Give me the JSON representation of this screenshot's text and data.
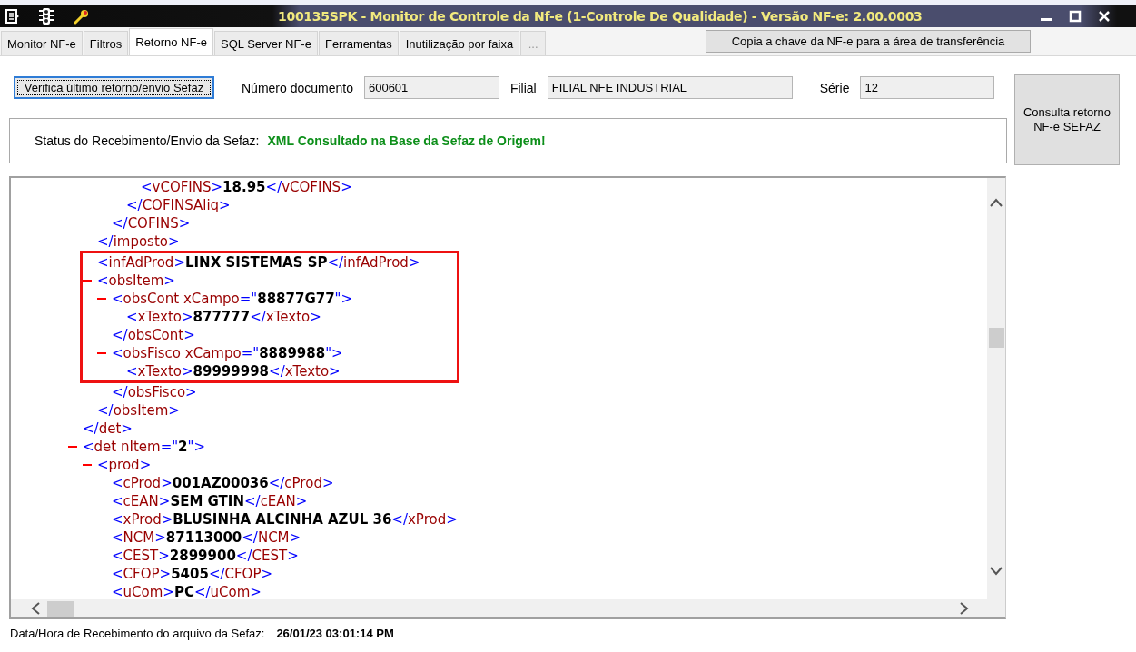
{
  "window": {
    "title": "100135SPK - Monitor de Controle da Nf-e (1-Controle De Qualidade) - Versão NF-e: 2.00.0003"
  },
  "tabs": [
    {
      "label": "Monitor NF-e",
      "selected": false
    },
    {
      "label": "Filtros",
      "selected": false
    },
    {
      "label": "Retorno NF-e",
      "selected": true
    },
    {
      "label": "SQL Server NF-e",
      "selected": false
    },
    {
      "label": "Ferramentas",
      "selected": false
    },
    {
      "label": "Inutilização por faixa",
      "selected": false
    },
    {
      "label": "...",
      "selected": false
    }
  ],
  "copy_key_button": "Copia a chave da NF-e para a área de transferência",
  "verify_button": "Verifica último retorno/envio Sefaz",
  "fields": [
    {
      "label": "Número documento",
      "value": "600601"
    },
    {
      "label": "Filial",
      "value": "FILIAL NFE INDUSTRIAL"
    },
    {
      "label": "Série",
      "value": "12"
    }
  ],
  "query_button": "Consulta retorno NF-e SEFAZ",
  "status": {
    "label": "Status do Recebimento/Envio da Sefaz:",
    "value": "XML Consultado na Base da Sefaz de Origem!"
  },
  "xml_view": {
    "nodes": [
      {
        "children": [
          {
            "children": [
              {
                "children": [
                  {
                    "children": [
                      {
                        "open": {
                          "highlighted": false,
                          "parts": [
                            {
                              "kind": "punct",
                              "text": "<"
                            },
                            {
                              "kind": "name",
                              "text": "vCOFINS"
                            },
                            {
                              "kind": "punct",
                              "text": ">"
                            },
                            {
                              "kind": "value",
                              "text": "18.95"
                            },
                            {
                              "kind": "punct",
                              "text": "</"
                            },
                            {
                              "kind": "name",
                              "text": "vCOFINS"
                            },
                            {
                              "kind": "punct",
                              "text": ">"
                            }
                          ]
                        }
                      }
                    ],
                    "close": {
                      "highlighted": false,
                      "parts": [
                        {
                          "kind": "punct",
                          "text": "</"
                        },
                        {
                          "kind": "name",
                          "text": "COFINSAliq"
                        },
                        {
                          "kind": "punct",
                          "text": ">"
                        }
                      ]
                    }
                  }
                ],
                "close": {
                  "highlighted": false,
                  "parts": [
                    {
                      "kind": "punct",
                      "text": "</"
                    },
                    {
                      "kind": "name",
                      "text": "COFINS"
                    },
                    {
                      "kind": "punct",
                      "text": ">"
                    }
                  ]
                }
              }
            ],
            "close": {
              "highlighted": false,
              "parts": [
                {
                  "kind": "punct",
                  "text": "</"
                },
                {
                  "kind": "name",
                  "text": "imposto"
                },
                {
                  "kind": "punct",
                  "text": ">"
                }
              ]
            }
          },
          {
            "open": {
              "highlighted": true,
              "parts": [
                {
                  "kind": "punct",
                  "text": "<"
                },
                {
                  "kind": "name",
                  "text": "infAdProd"
                },
                {
                  "kind": "punct",
                  "text": ">"
                },
                {
                  "kind": "value",
                  "text": "LINX SISTEMAS SP"
                },
                {
                  "kind": "punct",
                  "text": "</"
                },
                {
                  "kind": "name",
                  "text": "infAdProd"
                },
                {
                  "kind": "punct",
                  "text": ">"
                }
              ]
            }
          },
          {
            "expanded": true,
            "open": {
              "highlighted": true,
              "parts": [
                {
                  "kind": "punct",
                  "text": "<"
                },
                {
                  "kind": "name",
                  "text": "obsItem"
                },
                {
                  "kind": "punct",
                  "text": ">"
                }
              ]
            },
            "children": [
              {
                "expanded": true,
                "open": {
                  "highlighted": true,
                  "parts": [
                    {
                      "kind": "punct",
                      "text": "<"
                    },
                    {
                      "kind": "name",
                      "text": "obsCont xCampo"
                    },
                    {
                      "kind": "punct",
                      "text": "=\""
                    },
                    {
                      "kind": "value",
                      "text": "88877G77"
                    },
                    {
                      "kind": "punct",
                      "text": "\">"
                    }
                  ]
                },
                "children": [
                  {
                    "open": {
                      "highlighted": true,
                      "parts": [
                        {
                          "kind": "punct",
                          "text": "<"
                        },
                        {
                          "kind": "name",
                          "text": "xTexto"
                        },
                        {
                          "kind": "punct",
                          "text": ">"
                        },
                        {
                          "kind": "value",
                          "text": "877777"
                        },
                        {
                          "kind": "punct",
                          "text": "</"
                        },
                        {
                          "kind": "name",
                          "text": "xTexto"
                        },
                        {
                          "kind": "punct",
                          "text": ">"
                        }
                      ]
                    }
                  }
                ],
                "close": {
                  "highlighted": true,
                  "parts": [
                    {
                      "kind": "punct",
                      "text": "</"
                    },
                    {
                      "kind": "name",
                      "text": "obsCont"
                    },
                    {
                      "kind": "punct",
                      "text": ">"
                    }
                  ]
                }
              },
              {
                "expanded": true,
                "open": {
                  "highlighted": true,
                  "parts": [
                    {
                      "kind": "punct",
                      "text": "<"
                    },
                    {
                      "kind": "name",
                      "text": "obsFisco xCampo"
                    },
                    {
                      "kind": "punct",
                      "text": "=\""
                    },
                    {
                      "kind": "value",
                      "text": "8889988"
                    },
                    {
                      "kind": "punct",
                      "text": "\">"
                    }
                  ]
                },
                "children": [
                  {
                    "open": {
                      "highlighted": true,
                      "parts": [
                        {
                          "kind": "punct",
                          "text": "<"
                        },
                        {
                          "kind": "name",
                          "text": "xTexto"
                        },
                        {
                          "kind": "punct",
                          "text": ">"
                        },
                        {
                          "kind": "value",
                          "text": "89999998"
                        },
                        {
                          "kind": "punct",
                          "text": "</"
                        },
                        {
                          "kind": "name",
                          "text": "xTexto"
                        },
                        {
                          "kind": "punct",
                          "text": ">"
                        }
                      ]
                    }
                  }
                ],
                "close": {
                  "highlighted": false,
                  "parts": [
                    {
                      "kind": "punct",
                      "text": "</"
                    },
                    {
                      "kind": "name",
                      "text": "obsFisco"
                    },
                    {
                      "kind": "punct",
                      "text": ">"
                    }
                  ]
                }
              }
            ],
            "close": {
              "highlighted": false,
              "parts": [
                {
                  "kind": "punct",
                  "text": "</"
                },
                {
                  "kind": "name",
                  "text": "obsItem"
                },
                {
                  "kind": "punct",
                  "text": ">"
                }
              ]
            }
          }
        ],
        "close": {
          "highlighted": false,
          "parts": [
            {
              "kind": "punct",
              "text": "</"
            },
            {
              "kind": "name",
              "text": "det"
            },
            {
              "kind": "punct",
              "text": ">"
            }
          ]
        }
      },
      {
        "expanded": true,
        "open": {
          "highlighted": false,
          "parts": [
            {
              "kind": "punct",
              "text": "<"
            },
            {
              "kind": "name",
              "text": "det nItem"
            },
            {
              "kind": "punct",
              "text": "=\""
            },
            {
              "kind": "value",
              "text": "2"
            },
            {
              "kind": "punct",
              "text": "\">"
            }
          ]
        },
        "children": [
          {
            "expanded": true,
            "open": {
              "highlighted": false,
              "parts": [
                {
                  "kind": "punct",
                  "text": "<"
                },
                {
                  "kind": "name",
                  "text": "prod"
                },
                {
                  "kind": "punct",
                  "text": ">"
                }
              ]
            },
            "children": [
              {
                "open": {
                  "highlighted": false,
                  "parts": [
                    {
                      "kind": "punct",
                      "text": "<"
                    },
                    {
                      "kind": "name",
                      "text": "cProd"
                    },
                    {
                      "kind": "punct",
                      "text": ">"
                    },
                    {
                      "kind": "value",
                      "text": "001AZ00036"
                    },
                    {
                      "kind": "punct",
                      "text": "</"
                    },
                    {
                      "kind": "name",
                      "text": "cProd"
                    },
                    {
                      "kind": "punct",
                      "text": ">"
                    }
                  ]
                }
              },
              {
                "open": {
                  "highlighted": false,
                  "parts": [
                    {
                      "kind": "punct",
                      "text": "<"
                    },
                    {
                      "kind": "name",
                      "text": "cEAN"
                    },
                    {
                      "kind": "punct",
                      "text": ">"
                    },
                    {
                      "kind": "value",
                      "text": "SEM GTIN"
                    },
                    {
                      "kind": "punct",
                      "text": "</"
                    },
                    {
                      "kind": "name",
                      "text": "cEAN"
                    },
                    {
                      "kind": "punct",
                      "text": ">"
                    }
                  ]
                }
              },
              {
                "open": {
                  "highlighted": false,
                  "parts": [
                    {
                      "kind": "punct",
                      "text": "<"
                    },
                    {
                      "kind": "name",
                      "text": "xProd"
                    },
                    {
                      "kind": "punct",
                      "text": ">"
                    },
                    {
                      "kind": "value",
                      "text": "BLUSINHA ALCINHA AZUL 36"
                    },
                    {
                      "kind": "punct",
                      "text": "</"
                    },
                    {
                      "kind": "name",
                      "text": "xProd"
                    },
                    {
                      "kind": "punct",
                      "text": ">"
                    }
                  ]
                }
              },
              {
                "open": {
                  "highlighted": false,
                  "parts": [
                    {
                      "kind": "punct",
                      "text": "<"
                    },
                    {
                      "kind": "name",
                      "text": "NCM"
                    },
                    {
                      "kind": "punct",
                      "text": ">"
                    },
                    {
                      "kind": "value",
                      "text": "87113000"
                    },
                    {
                      "kind": "punct",
                      "text": "</"
                    },
                    {
                      "kind": "name",
                      "text": "NCM"
                    },
                    {
                      "kind": "punct",
                      "text": ">"
                    }
                  ]
                }
              },
              {
                "open": {
                  "highlighted": false,
                  "parts": [
                    {
                      "kind": "punct",
                      "text": "<"
                    },
                    {
                      "kind": "name",
                      "text": "CEST"
                    },
                    {
                      "kind": "punct",
                      "text": ">"
                    },
                    {
                      "kind": "value",
                      "text": "2899900"
                    },
                    {
                      "kind": "punct",
                      "text": "</"
                    },
                    {
                      "kind": "name",
                      "text": "CEST"
                    },
                    {
                      "kind": "punct",
                      "text": ">"
                    }
                  ]
                }
              },
              {
                "open": {
                  "highlighted": false,
                  "parts": [
                    {
                      "kind": "punct",
                      "text": "<"
                    },
                    {
                      "kind": "name",
                      "text": "CFOP"
                    },
                    {
                      "kind": "punct",
                      "text": ">"
                    },
                    {
                      "kind": "value",
                      "text": "5405"
                    },
                    {
                      "kind": "punct",
                      "text": "</"
                    },
                    {
                      "kind": "name",
                      "text": "CFOP"
                    },
                    {
                      "kind": "punct",
                      "text": ">"
                    }
                  ]
                }
              },
              {
                "open": {
                  "highlighted": false,
                  "parts": [
                    {
                      "kind": "punct",
                      "text": "<"
                    },
                    {
                      "kind": "name",
                      "text": "uCom"
                    },
                    {
                      "kind": "punct",
                      "text": ">"
                    },
                    {
                      "kind": "value",
                      "text": "PC"
                    },
                    {
                      "kind": "punct",
                      "text": "</"
                    },
                    {
                      "kind": "name",
                      "text": "uCom"
                    },
                    {
                      "kind": "punct",
                      "text": ">"
                    }
                  ]
                }
              }
            ]
          }
        ]
      }
    ]
  },
  "footer": {
    "label": "Data/Hora de Recebimento do arquivo da Sefaz:",
    "value": "26/01/23 03:01:14 PM"
  }
}
